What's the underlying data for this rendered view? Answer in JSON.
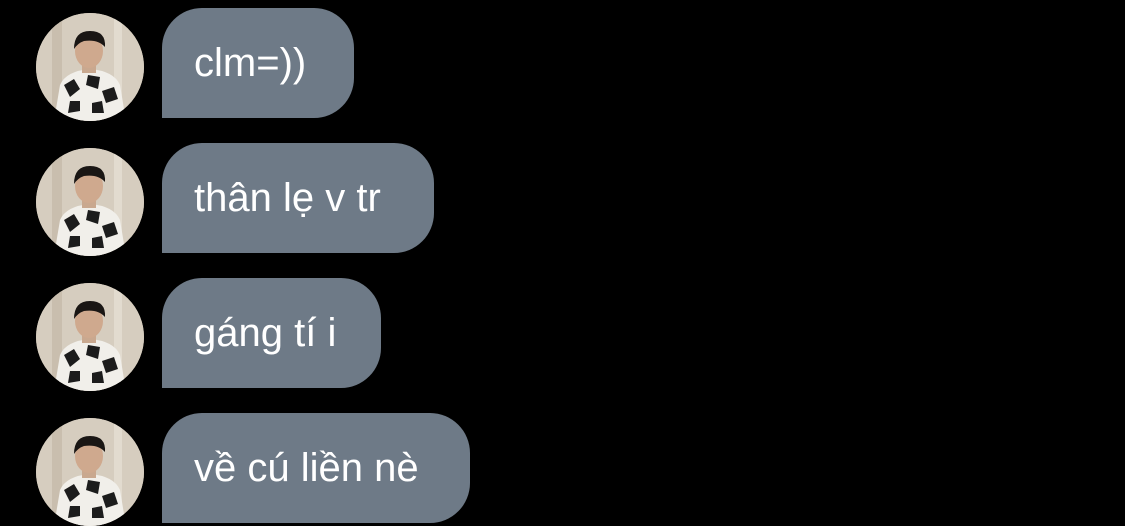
{
  "conversation": {
    "messages": [
      {
        "sender_avatar": "avatar-photo",
        "text": "clm=))"
      },
      {
        "sender_avatar": "avatar-photo",
        "text": "thân lẹ v tr"
      },
      {
        "sender_avatar": "avatar-photo",
        "text": "gáng tí i"
      },
      {
        "sender_avatar": "avatar-photo",
        "text": "về cú liền nè"
      }
    ]
  },
  "colors": {
    "background": "#000000",
    "bubble": "#6e7a87",
    "text": "#ffffff"
  }
}
